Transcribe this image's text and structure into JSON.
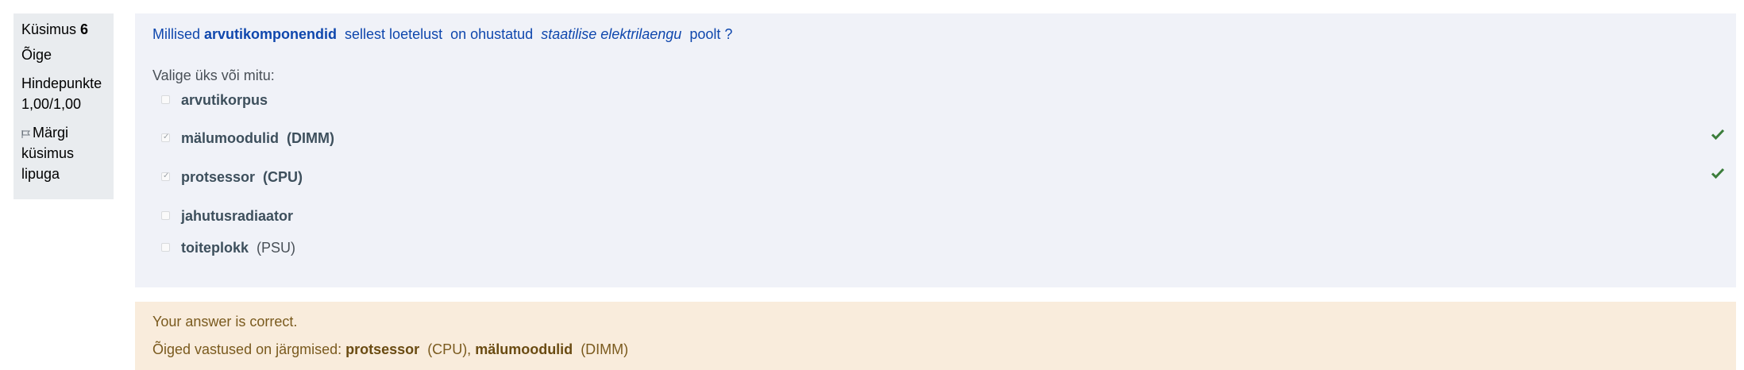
{
  "info": {
    "question_label": "Küsimus",
    "question_number": "6",
    "state": "Õige",
    "grade_label": "Hindepunkte",
    "grade_value": "1,00/1,00",
    "flag_label_1": "Märgi",
    "flag_label_2": "küsimus",
    "flag_label_3": "lipuga"
  },
  "question": {
    "part1": "Millised ",
    "part2": "arvutikomponendid",
    "part3": "  sellest loetelust  on ohustatud  ",
    "part4": "staatilise elektrilaengu",
    "part5": "  poolt ?",
    "prompt": "Valige üks või mitu:"
  },
  "options": [
    {
      "name": "arvutikorpus",
      "extra": "",
      "checked": false,
      "correct": false
    },
    {
      "name": "mälumoodulid",
      "extra": "  (DIMM)",
      "checked": true,
      "correct": true
    },
    {
      "name": "protsessor",
      "extra": "  (CPU)",
      "checked": true,
      "correct": true
    },
    {
      "name": "jahutusradiaator",
      "extra": "",
      "checked": false,
      "correct": false
    },
    {
      "name": "toiteplokk",
      "extra": "  (PSU)",
      "checked": false,
      "correct": false
    }
  ],
  "feedback": {
    "result": "Your answer is correct.",
    "right_prefix": "Õiged vastused on järgmised: ",
    "ans1_name": "protsessor",
    "ans1_extra": "  (CPU), ",
    "ans2_name": "mälumoodulid",
    "ans2_extra": "  (DIMM)"
  },
  "colors": {
    "question_text": "#0f47ad",
    "correct_check": "#3b7d3b",
    "feedback_bg": "#f9ecdc",
    "formulation_bg": "#f0f2f8"
  }
}
